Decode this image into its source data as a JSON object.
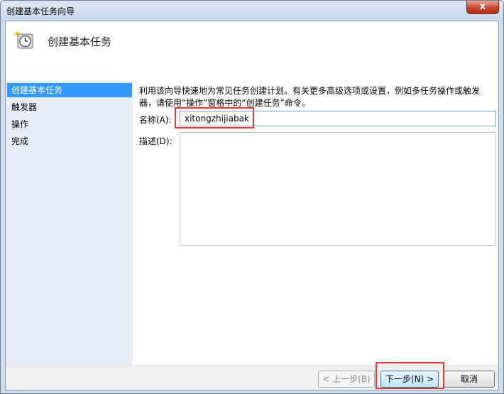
{
  "window": {
    "title": "创建基本任务向导",
    "close_glyph": "x"
  },
  "header": {
    "icon": "task-scheduler-clock-icon",
    "title": "创建基本任务"
  },
  "sidebar": {
    "items": [
      {
        "label": "创建基本任务",
        "active": true
      },
      {
        "label": "触发器",
        "active": false
      },
      {
        "label": "操作",
        "active": false
      },
      {
        "label": "完成",
        "active": false
      }
    ]
  },
  "main": {
    "description_line1": "利用该向导快速地为常见任务创建计划。有关更多高级选项或设置，例如多任务操作或触发",
    "description_line2": "器，请使用“操作”窗格中的“创建任务”命令。",
    "name_label": "名称(A):",
    "name_value": "xitongzhijiabak",
    "desc_label": "描述(D):",
    "desc_value": ""
  },
  "footer": {
    "back_label": "< 上一步(B)",
    "next_label": "下一步(N) >",
    "cancel_label": "取消"
  },
  "colors": {
    "highlight": "#e53935",
    "selection": "#3399ff"
  }
}
